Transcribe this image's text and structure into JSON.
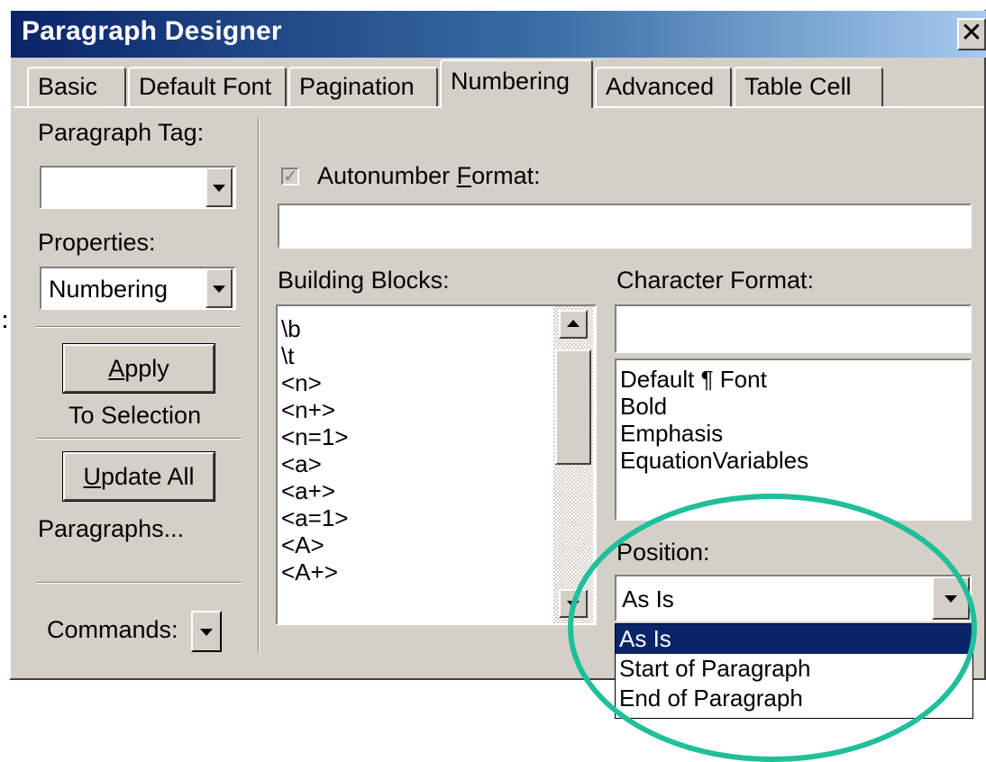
{
  "window": {
    "title": "Paragraph Designer",
    "close_glyph": "✕"
  },
  "tabs": [
    {
      "label": "Basic",
      "active": false
    },
    {
      "label": "Default Font",
      "active": false
    },
    {
      "label": "Pagination",
      "active": false
    },
    {
      "label": "Numbering",
      "active": true
    },
    {
      "label": "Advanced",
      "active": false
    },
    {
      "label": "Table Cell",
      "active": false
    }
  ],
  "left_panel": {
    "paragraph_tag_label": "Paragraph Tag:",
    "paragraph_tag_value": "",
    "properties_label": "Properties:",
    "properties_value": "Numbering",
    "apply_mnemonic": "A",
    "apply_rest": "pply",
    "to_selection": "To Selection",
    "update_mnemonic": "U",
    "update_rest": "pdate All",
    "paragraphs": "Paragraphs...",
    "commands_label": "Commands:"
  },
  "autonumber": {
    "checked": true,
    "check_glyph": "✓",
    "label_prefix": "Autonumber ",
    "label_mnemonic": "F",
    "label_suffix": "ormat:",
    "value": ""
  },
  "building_blocks": {
    "label": "Building Blocks:",
    "items": [
      "\\b",
      "\\t",
      "<n>",
      "<n+>",
      "<n=1>",
      "<a>",
      "<a+>",
      "<a=1>",
      "<A>",
      "<A+>"
    ]
  },
  "character_format": {
    "label": "Character Format:",
    "value": "",
    "items": [
      "Default ¶ Font",
      "Bold",
      "Emphasis",
      "EquationVariables"
    ]
  },
  "position": {
    "label": "Position:",
    "value": "As Is",
    "options": [
      "As Is",
      "Start of Paragraph",
      "End of Paragraph"
    ],
    "selected_index": 0
  },
  "colors": {
    "title_bar": "#0a246a",
    "dialog_bg": "#d4d0c8",
    "selection": "#0a246a",
    "annotation_ellipse": "#1fbf9a"
  }
}
